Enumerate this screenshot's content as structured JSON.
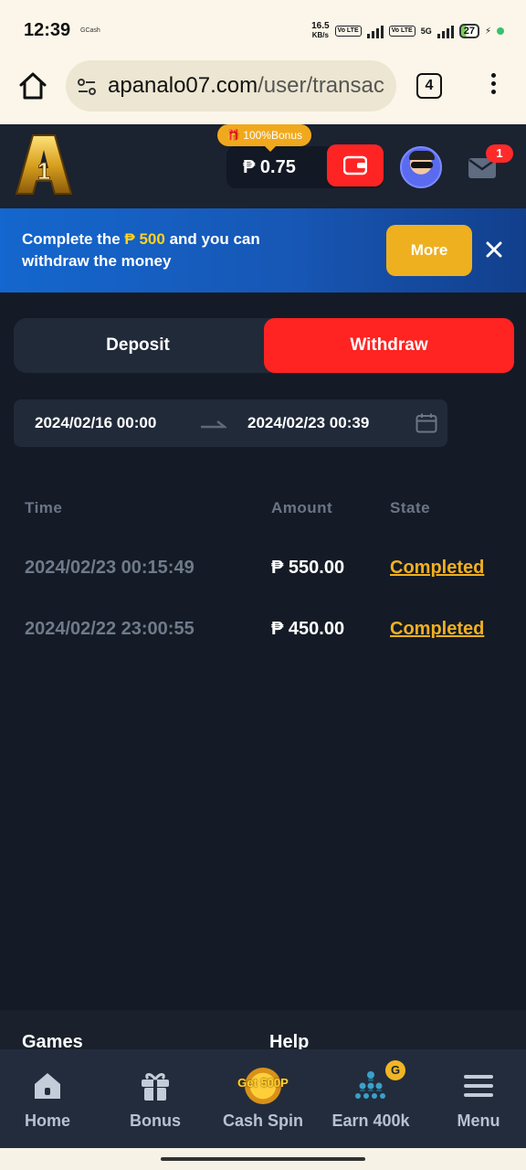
{
  "status_bar": {
    "time": "12:39",
    "gcash": "GCash",
    "speed_top": "16.5",
    "speed_bottom": "KB/s",
    "volte1": "Vo LTE",
    "volte2": "Vo LTE",
    "network": "5G",
    "battery": "27"
  },
  "browser": {
    "url_host": "apanalo07.com",
    "url_path": "/user/transac",
    "tab_count": "4"
  },
  "header": {
    "bonus_tag": "🎁 100%Bonus",
    "balance": "₱ 0.75",
    "mail_count": "1"
  },
  "banner": {
    "text_before": "Complete the ",
    "amount": "₱ 500",
    "text_after": " and you can withdraw the money",
    "more_label": "More"
  },
  "tabs": {
    "deposit": "Deposit",
    "withdraw": "Withdraw",
    "active": "withdraw"
  },
  "date_range": {
    "start": "2024/02/16 00:00",
    "end": "2024/02/23 00:39"
  },
  "table": {
    "headers": [
      "Time",
      "Amount",
      "State"
    ],
    "rows": [
      {
        "time": "2024/02/23 00:15:49",
        "amount": "₱ 550.00",
        "state": "Completed"
      },
      {
        "time": "2024/02/22 23:00:55",
        "amount": "₱ 450.00",
        "state": "Completed"
      }
    ]
  },
  "footer_peek": {
    "col1": "Games",
    "col2": "Help"
  },
  "bottom_nav": {
    "items": [
      {
        "label": "Home",
        "icon": "home-icon"
      },
      {
        "label": "Bonus",
        "icon": "gift-icon"
      },
      {
        "label": "Cash Spin",
        "icon": "spin-coin-icon",
        "badge_text": "Get 500P"
      },
      {
        "label": "Earn 400k",
        "icon": "network-icon",
        "badge": "G"
      },
      {
        "label": "Menu",
        "icon": "hamburger-icon"
      }
    ]
  },
  "colors": {
    "accent_red": "#ff2322",
    "gold": "#f0b020",
    "banner_blue": "#1467ce",
    "background": "#141b26"
  }
}
